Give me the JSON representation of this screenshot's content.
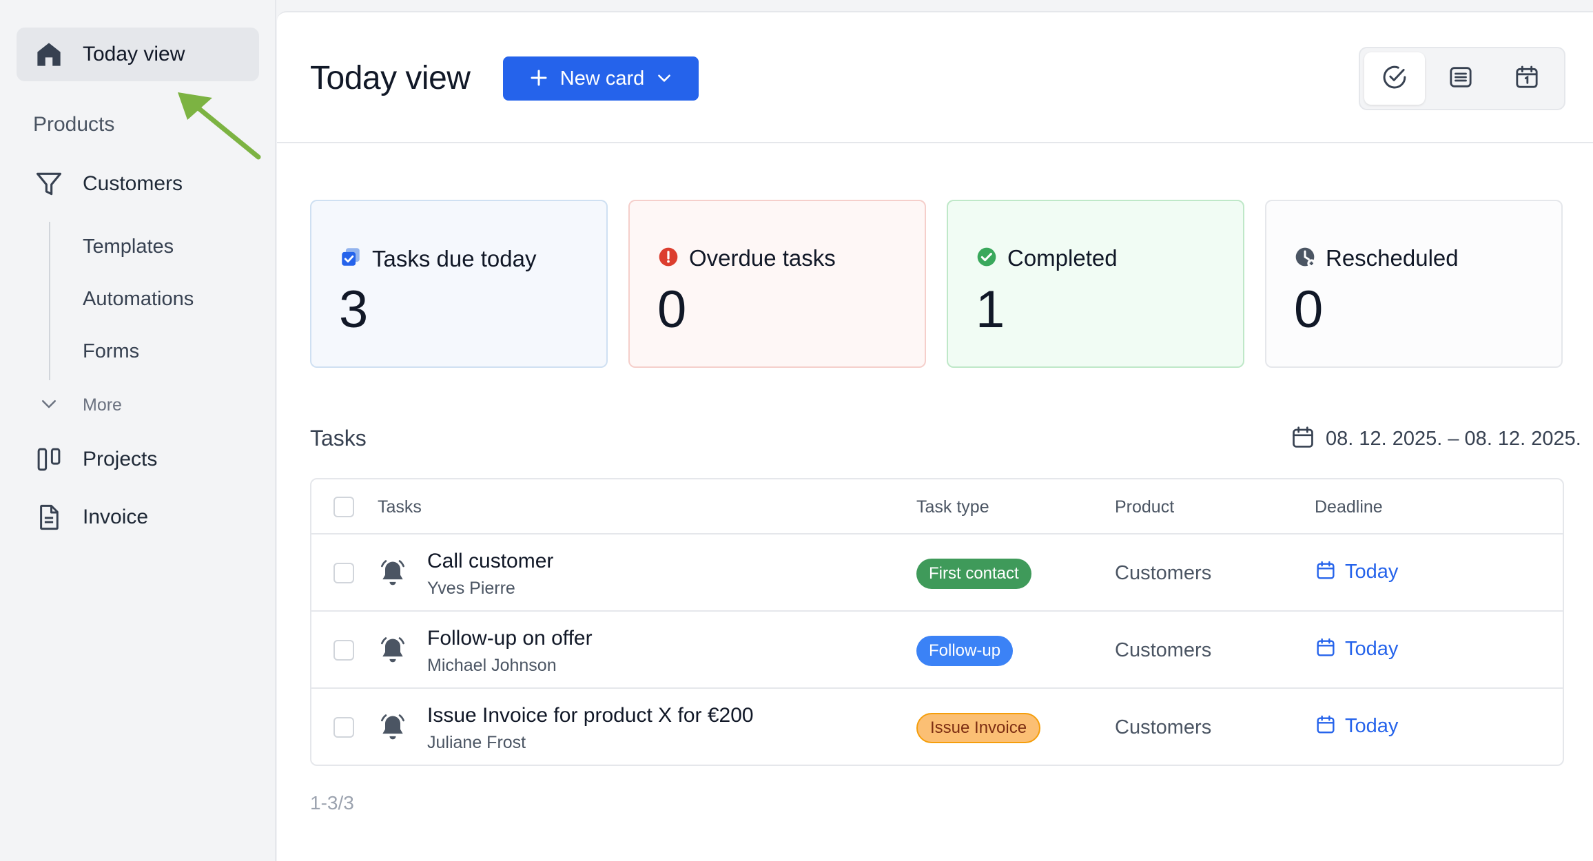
{
  "sidebar": {
    "today_view": "Today view",
    "products_label": "Products",
    "customers": "Customers",
    "sub_items": [
      "Templates",
      "Automations",
      "Forms"
    ],
    "more": "More",
    "projects": "Projects",
    "invoice": "Invoice"
  },
  "header": {
    "title": "Today view",
    "new_card": "New card",
    "view_icons": [
      "check-circle-icon",
      "list-icon",
      "calendar-icon"
    ]
  },
  "stats": [
    {
      "label": "Tasks due today",
      "value": "3",
      "icon": "checkbox-icon"
    },
    {
      "label": "Overdue tasks",
      "value": "0",
      "icon": "alert-icon"
    },
    {
      "label": "Completed",
      "value": "1",
      "icon": "check-icon"
    },
    {
      "label": "Rescheduled",
      "value": "0",
      "icon": "clock-icon"
    }
  ],
  "tasks": {
    "title": "Tasks",
    "date_range": "08. 12. 2025. – 08. 12. 2025.",
    "columns": [
      "Tasks",
      "Task type",
      "Product",
      "Deadline"
    ],
    "rows": [
      {
        "title": "Call customer",
        "person": "Yves Pierre",
        "type": "First contact",
        "product": "Customers",
        "deadline": "Today"
      },
      {
        "title": "Follow-up on offer",
        "person": "Michael Johnson",
        "type": "Follow-up",
        "product": "Customers",
        "deadline": "Today"
      },
      {
        "title": "Issue Invoice for product X for €200",
        "person": "Juliane Frost",
        "type": "Issue Invoice",
        "product": "Customers",
        "deadline": "Today"
      }
    ],
    "pagination": "1-3/3"
  },
  "colors": {
    "accent": "#2563eb",
    "badge_first_contact": "#3f9a5a",
    "badge_follow_up": "#3b82f6",
    "badge_issue_invoice": "#fbbf74",
    "annotation_arrow": "#7cb342"
  }
}
